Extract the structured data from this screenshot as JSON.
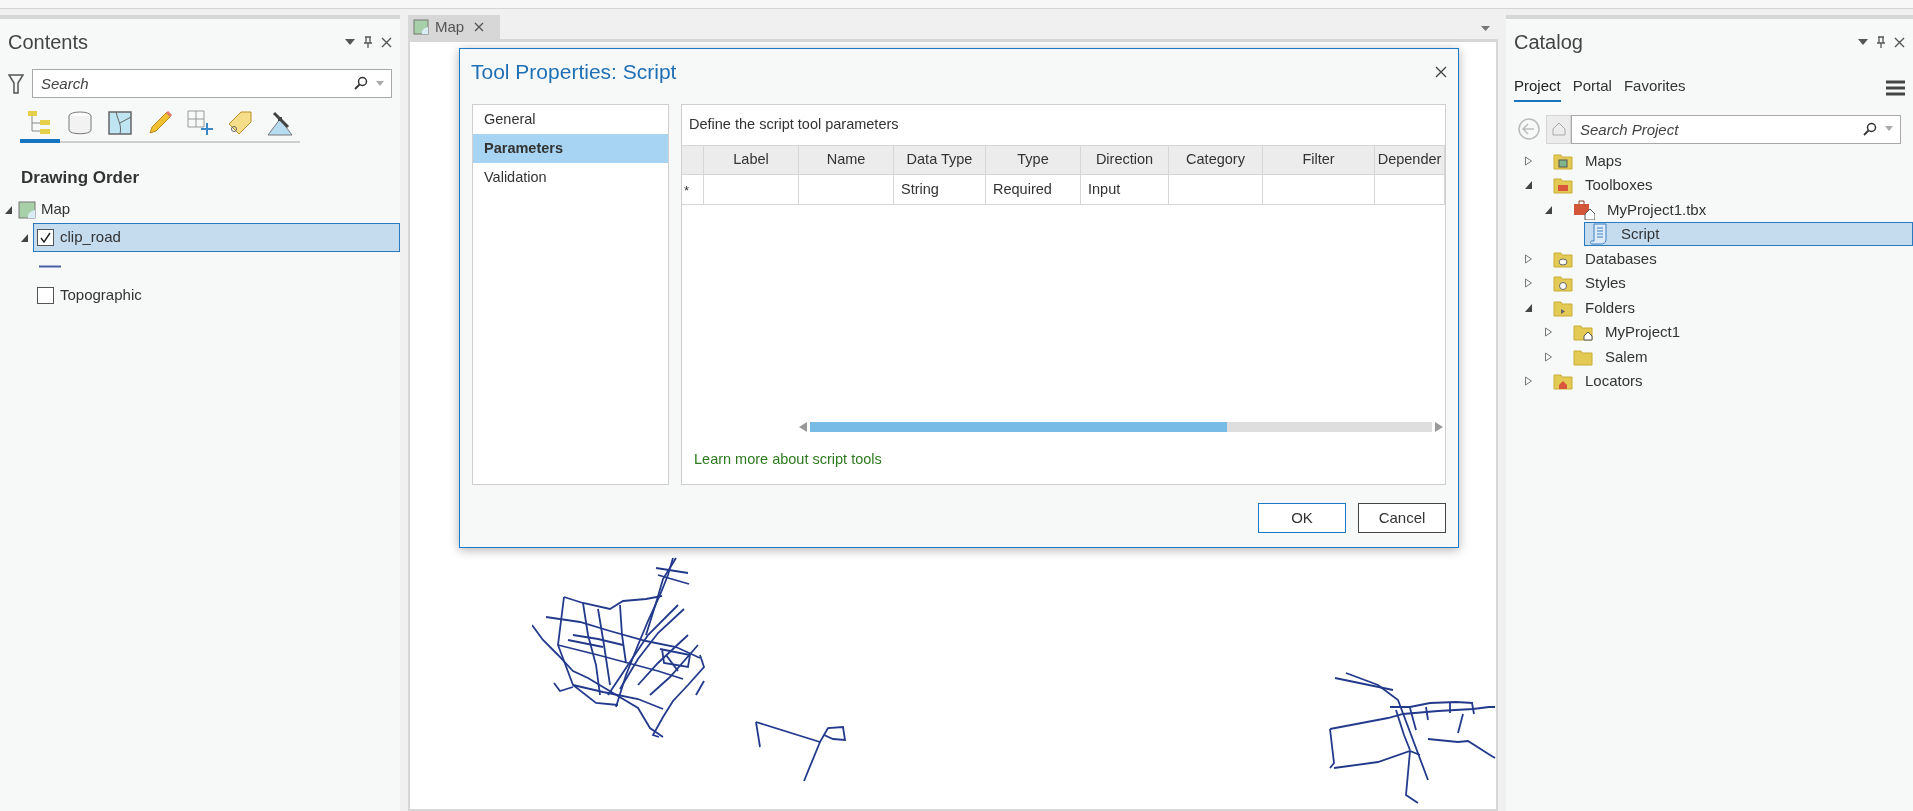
{
  "contents_pane": {
    "title": "Contents",
    "search": {
      "placeholder": "Search"
    },
    "tabs": [
      {
        "kind": "order",
        "selected": true
      },
      {
        "kind": "source",
        "selected": false
      },
      {
        "kind": "selection",
        "selected": false
      },
      {
        "kind": "editing",
        "selected": false
      },
      {
        "kind": "snapping",
        "selected": false
      },
      {
        "kind": "labeling",
        "selected": false
      },
      {
        "kind": "imagery",
        "selected": false
      }
    ],
    "heading": "Drawing Order",
    "layers": [
      {
        "label": "Map",
        "expanded": true,
        "selected": false,
        "children": [
          {
            "label": "clip_road",
            "checked": true,
            "expanded": true,
            "selected": true
          },
          {
            "label": "Topographic",
            "checked": false,
            "expanded": false,
            "selected": false
          }
        ]
      }
    ]
  },
  "map_view": {
    "tab": {
      "label": "Map",
      "selected": true
    }
  },
  "dialog": {
    "title": "Tool Properties: Script",
    "nav": [
      {
        "label": "General",
        "selected": false
      },
      {
        "label": "Parameters",
        "selected": true
      },
      {
        "label": "Validation",
        "selected": false
      }
    ],
    "description": "Define the script tool parameters",
    "columns": [
      "Label",
      "Name",
      "Data Type",
      "Type",
      "Direction",
      "Category",
      "Filter",
      "Depender"
    ],
    "rows": [
      {
        "marker": "*",
        "data_type": "String",
        "type": "Required",
        "direction": "Input"
      }
    ],
    "link": "Learn more about script tools",
    "buttons": [
      {
        "label": "OK",
        "kind": "default"
      },
      {
        "label": "Cancel",
        "kind": "normal"
      }
    ]
  },
  "catalog": {
    "title": "Catalog",
    "tabs": [
      {
        "label": "Project",
        "selected": true
      },
      {
        "label": "Portal",
        "selected": false
      },
      {
        "label": "Favorites",
        "selected": false
      }
    ],
    "search": {
      "placeholder": "Search Project"
    },
    "items": [
      {
        "label": "Maps",
        "kind": "maps",
        "expanded": false,
        "selected": false
      },
      {
        "label": "Toolboxes",
        "kind": "toolboxes",
        "expanded": true,
        "selected": false,
        "children": [
          {
            "label": "MyProject1.tbx",
            "kind": "toolbox",
            "expanded": true,
            "selected": false,
            "children": [
              {
                "label": "Script",
                "kind": "script",
                "selected": true
              }
            ]
          }
        ]
      },
      {
        "label": "Databases",
        "kind": "databases",
        "expanded": false,
        "selected": false
      },
      {
        "label": "Styles",
        "kind": "styles",
        "expanded": false,
        "selected": false
      },
      {
        "label": "Folders",
        "kind": "folders",
        "expanded": true,
        "selected": false,
        "children": [
          {
            "label": "MyProject1",
            "kind": "homefolder",
            "expanded": false,
            "selected": false
          },
          {
            "label": "Salem",
            "kind": "folder",
            "expanded": false,
            "selected": false
          }
        ]
      },
      {
        "label": "Locators",
        "kind": "locators",
        "expanded": false,
        "selected": false
      }
    ]
  }
}
